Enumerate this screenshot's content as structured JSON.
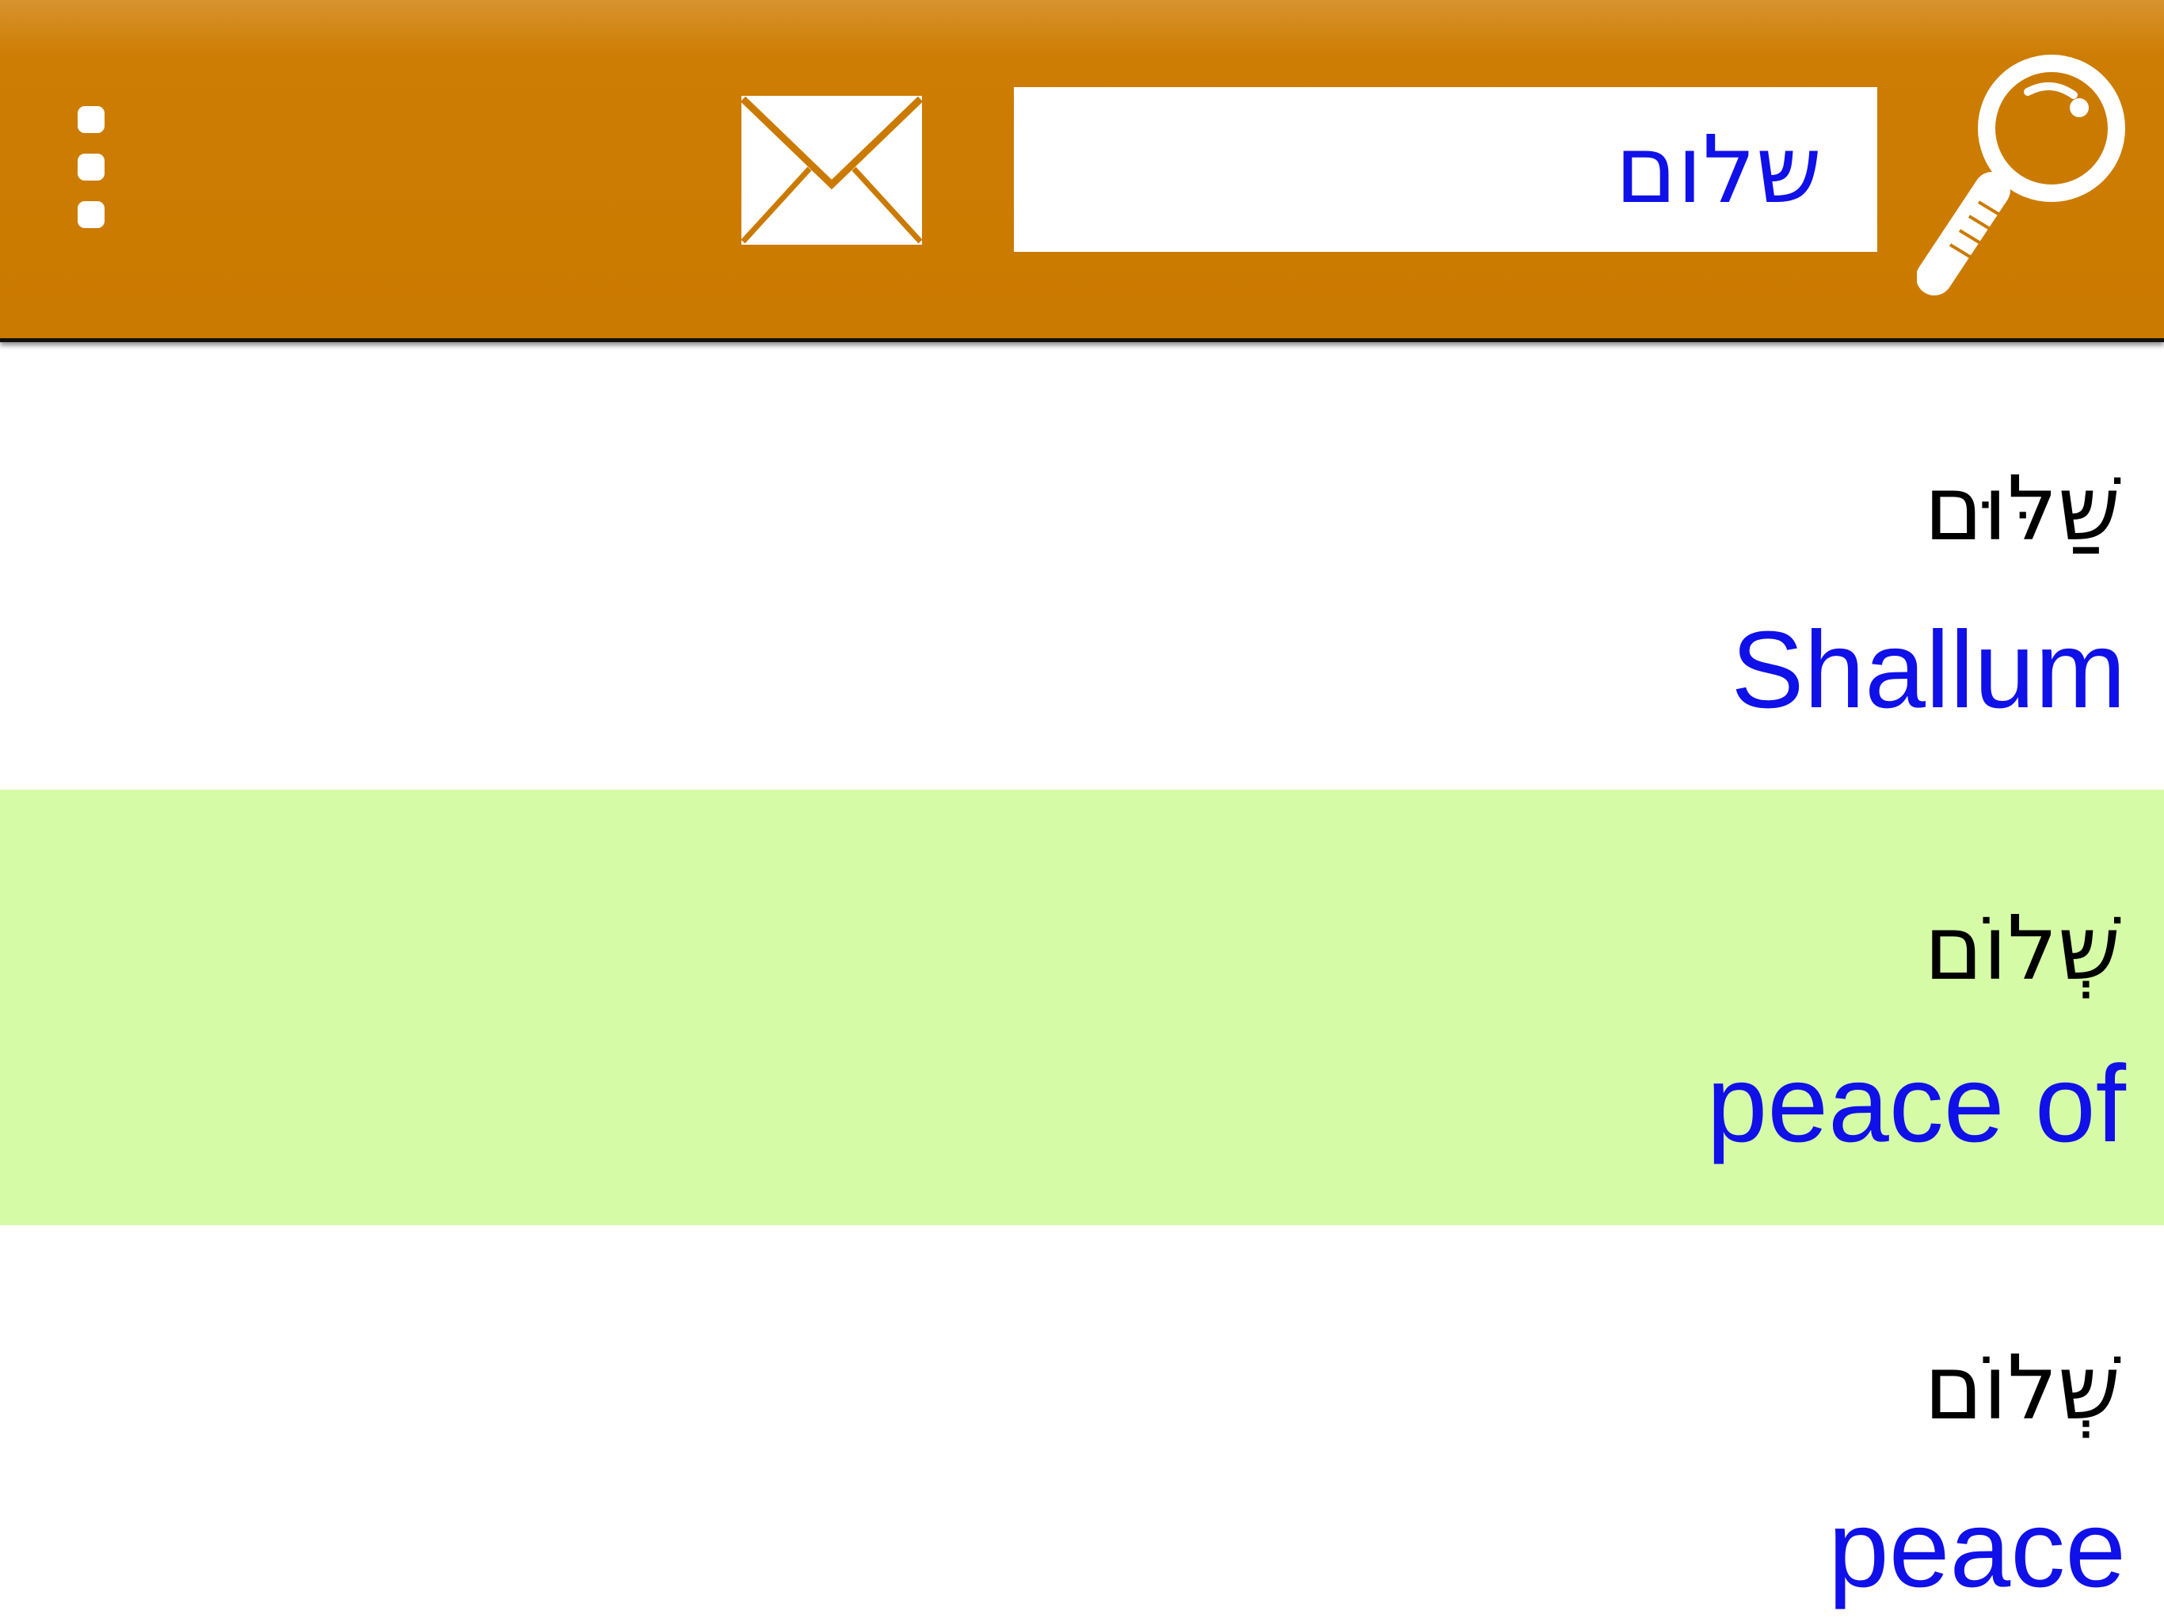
{
  "toolbar": {
    "search_value": "שלום",
    "overflow_icon": "overflow-menu-icon",
    "mail_icon": "envelope-icon",
    "search_icon": "magnifier-icon",
    "background_color": "#cb7a00"
  },
  "results": [
    {
      "hebrew": "שַׁלּוּם",
      "english": "Shallum",
      "selected": false
    },
    {
      "hebrew": "שְׁלוֹם",
      "english": "peace of",
      "selected": true
    },
    {
      "hebrew": "שְׁלוֹם",
      "english": "peace",
      "selected": false
    }
  ],
  "colors": {
    "gloss_text": "#1010e8",
    "selected_row": "#d5fba6",
    "hebrew_text": "#000000"
  }
}
